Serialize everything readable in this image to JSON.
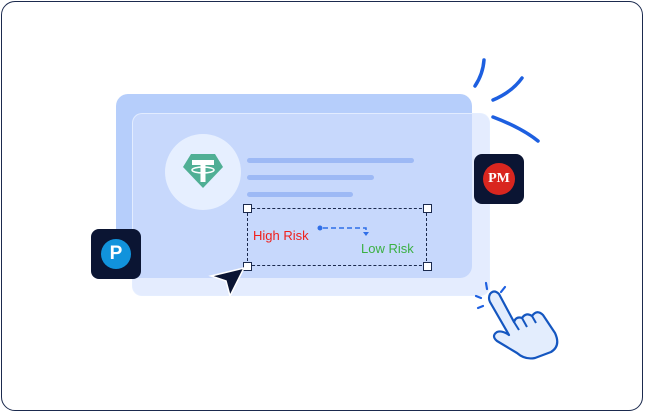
{
  "card": {
    "coin_icon": "tether-icon",
    "high_risk_label": "High Risk",
    "low_risk_label": "Low Risk"
  },
  "apps": {
    "pm_label": "PM",
    "p_label": "P"
  },
  "colors": {
    "high_risk": "#f0201c",
    "low_risk": "#3bb043",
    "accent": "#1d5fe0",
    "tether": "#50af95"
  }
}
